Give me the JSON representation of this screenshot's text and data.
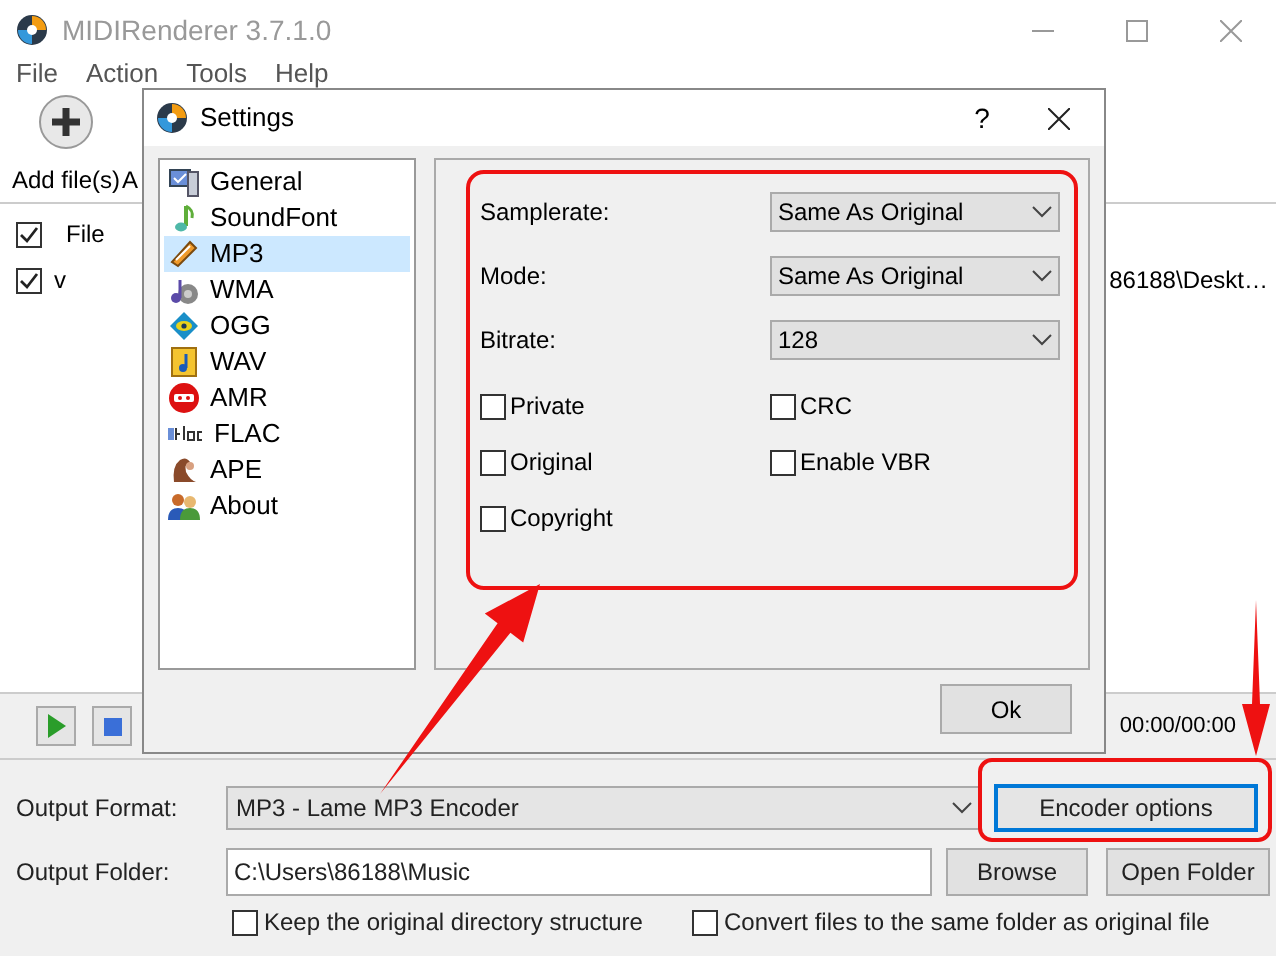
{
  "window": {
    "title": "MIDIRenderer 3.7.1.0"
  },
  "menu": [
    "File",
    "Action",
    "Tools",
    "Help"
  ],
  "toolbar": [
    {
      "label": "Add file(s)"
    },
    {
      "label": "A"
    }
  ],
  "file_list": {
    "header": {
      "checked": true,
      "label": "File"
    },
    "rows": [
      {
        "checked": true,
        "name": "v",
        "path": "86188\\Deskt…"
      }
    ]
  },
  "player": {
    "time": "00:00/00:00"
  },
  "output": {
    "format_label": "Output Format:",
    "format": "MP3 - Lame MP3 Encoder",
    "encoder_button": "Encoder options",
    "folder_label": "Output Folder:",
    "folder": "C:\\Users\\86188\\Music",
    "browse": "Browse",
    "open_folder": "Open Folder",
    "options": [
      {
        "label": "Keep the original directory structure",
        "checked": false
      },
      {
        "label": "Convert files to the same folder as original file",
        "checked": false
      }
    ]
  },
  "dialog": {
    "title": "Settings",
    "help": "?",
    "categories": [
      {
        "label": "General",
        "selected": false
      },
      {
        "label": "SoundFont",
        "selected": false
      },
      {
        "label": "MP3",
        "selected": true
      },
      {
        "label": "WMA",
        "selected": false
      },
      {
        "label": "OGG",
        "selected": false
      },
      {
        "label": "WAV",
        "selected": false
      },
      {
        "label": "AMR",
        "selected": false
      },
      {
        "label": "FLAC",
        "selected": false
      },
      {
        "label": "APE",
        "selected": false
      },
      {
        "label": "About",
        "selected": false
      }
    ],
    "fields": [
      {
        "label": "Samplerate:",
        "value": "Same As Original"
      },
      {
        "label": "Mode:",
        "value": "Same As Original"
      },
      {
        "label": "Bitrate:",
        "value": "128"
      }
    ],
    "checkboxes": [
      {
        "label": "Private",
        "checked": false
      },
      {
        "label": "CRC",
        "checked": false
      },
      {
        "label": "Original",
        "checked": false
      },
      {
        "label": "Enable VBR",
        "checked": false
      },
      {
        "label": "Copyright",
        "checked": false
      }
    ],
    "ok": "Ok"
  }
}
